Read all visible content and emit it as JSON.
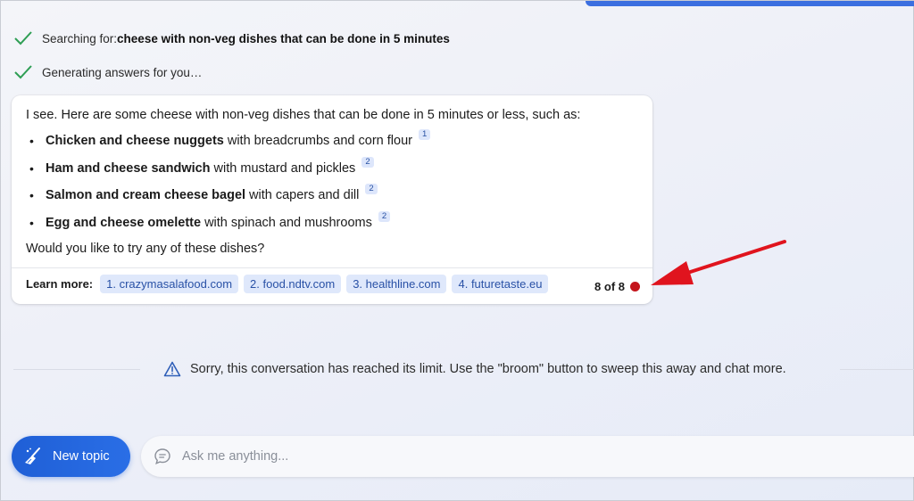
{
  "status": {
    "searching_prefix": "Searching for: ",
    "searching_query": "cheese with non-veg dishes that can be done in 5 minutes",
    "generating": "Generating answers for you…",
    "icon": "check-icon"
  },
  "answer": {
    "intro": "I see. Here are some cheese with non-veg dishes that can be done in 5 minutes or less, such as:",
    "items": [
      {
        "bullet": "•",
        "title": "Chicken and cheese nuggets",
        "detail": "with breadcrumbs and corn flour",
        "cite": "1"
      },
      {
        "bullet": "•",
        "title": "Ham and cheese sandwich",
        "detail": "with mustard and pickles",
        "cite": "2"
      },
      {
        "bullet": "•",
        "title": "Salmon and cream cheese bagel",
        "detail": "with capers and dill",
        "cite": "2"
      },
      {
        "bullet": "•",
        "title": "Egg and cheese omelette",
        "detail": "with spinach and mushrooms",
        "cite": "2"
      }
    ],
    "outro": "Would you like to try any of these dishes?",
    "learn_more_label": "Learn more:",
    "sources": [
      "1. crazymasalafood.com",
      "2. food.ndtv.com",
      "3. healthline.com",
      "4. futuretaste.eu"
    ],
    "turn_count": "8 of 8",
    "turn_dot_color": "#c4151c"
  },
  "limit_message": "Sorry, this conversation has reached its limit. Use the \"broom\" button to sweep this away and chat more.",
  "composer": {
    "new_topic_label": "New topic",
    "placeholder": "Ask me anything..."
  },
  "colors": {
    "accent": "#2a6ee6",
    "chip_bg": "#dfe8fb",
    "arrow": "#e0141e"
  }
}
